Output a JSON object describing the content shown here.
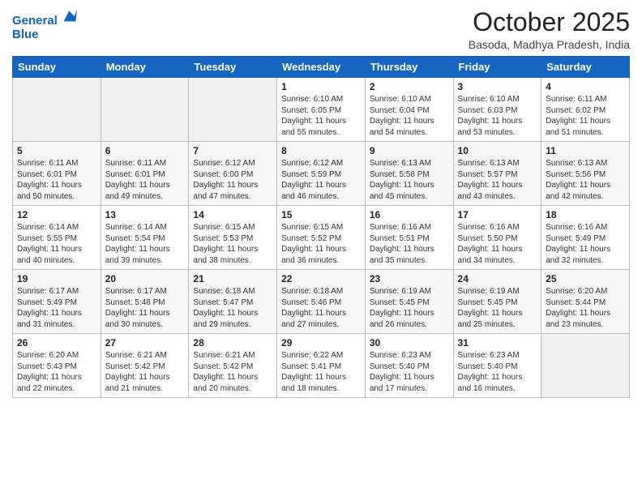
{
  "header": {
    "logo_line1": "General",
    "logo_line2": "Blue",
    "month": "October 2025",
    "location": "Basoda, Madhya Pradesh, India"
  },
  "weekdays": [
    "Sunday",
    "Monday",
    "Tuesday",
    "Wednesday",
    "Thursday",
    "Friday",
    "Saturday"
  ],
  "weeks": [
    [
      {
        "day": "",
        "empty": true
      },
      {
        "day": "",
        "empty": true
      },
      {
        "day": "",
        "empty": true
      },
      {
        "day": "1",
        "info": "Sunrise: 6:10 AM\nSunset: 6:05 PM\nDaylight: 11 hours\nand 55 minutes."
      },
      {
        "day": "2",
        "info": "Sunrise: 6:10 AM\nSunset: 6:04 PM\nDaylight: 11 hours\nand 54 minutes."
      },
      {
        "day": "3",
        "info": "Sunrise: 6:10 AM\nSunset: 6:03 PM\nDaylight: 11 hours\nand 53 minutes."
      },
      {
        "day": "4",
        "info": "Sunrise: 6:11 AM\nSunset: 6:02 PM\nDaylight: 11 hours\nand 51 minutes."
      }
    ],
    [
      {
        "day": "5",
        "info": "Sunrise: 6:11 AM\nSunset: 6:01 PM\nDaylight: 11 hours\nand 50 minutes."
      },
      {
        "day": "6",
        "info": "Sunrise: 6:11 AM\nSunset: 6:01 PM\nDaylight: 11 hours\nand 49 minutes."
      },
      {
        "day": "7",
        "info": "Sunrise: 6:12 AM\nSunset: 6:00 PM\nDaylight: 11 hours\nand 47 minutes."
      },
      {
        "day": "8",
        "info": "Sunrise: 6:12 AM\nSunset: 5:59 PM\nDaylight: 11 hours\nand 46 minutes."
      },
      {
        "day": "9",
        "info": "Sunrise: 6:13 AM\nSunset: 5:58 PM\nDaylight: 11 hours\nand 45 minutes."
      },
      {
        "day": "10",
        "info": "Sunrise: 6:13 AM\nSunset: 5:57 PM\nDaylight: 11 hours\nand 43 minutes."
      },
      {
        "day": "11",
        "info": "Sunrise: 6:13 AM\nSunset: 5:56 PM\nDaylight: 11 hours\nand 42 minutes."
      }
    ],
    [
      {
        "day": "12",
        "info": "Sunrise: 6:14 AM\nSunset: 5:55 PM\nDaylight: 11 hours\nand 40 minutes."
      },
      {
        "day": "13",
        "info": "Sunrise: 6:14 AM\nSunset: 5:54 PM\nDaylight: 11 hours\nand 39 minutes."
      },
      {
        "day": "14",
        "info": "Sunrise: 6:15 AM\nSunset: 5:53 PM\nDaylight: 11 hours\nand 38 minutes."
      },
      {
        "day": "15",
        "info": "Sunrise: 6:15 AM\nSunset: 5:52 PM\nDaylight: 11 hours\nand 36 minutes."
      },
      {
        "day": "16",
        "info": "Sunrise: 6:16 AM\nSunset: 5:51 PM\nDaylight: 11 hours\nand 35 minutes."
      },
      {
        "day": "17",
        "info": "Sunrise: 6:16 AM\nSunset: 5:50 PM\nDaylight: 11 hours\nand 34 minutes."
      },
      {
        "day": "18",
        "info": "Sunrise: 6:16 AM\nSunset: 5:49 PM\nDaylight: 11 hours\nand 32 minutes."
      }
    ],
    [
      {
        "day": "19",
        "info": "Sunrise: 6:17 AM\nSunset: 5:49 PM\nDaylight: 11 hours\nand 31 minutes."
      },
      {
        "day": "20",
        "info": "Sunrise: 6:17 AM\nSunset: 5:48 PM\nDaylight: 11 hours\nand 30 minutes."
      },
      {
        "day": "21",
        "info": "Sunrise: 6:18 AM\nSunset: 5:47 PM\nDaylight: 11 hours\nand 29 minutes."
      },
      {
        "day": "22",
        "info": "Sunrise: 6:18 AM\nSunset: 5:46 PM\nDaylight: 11 hours\nand 27 minutes."
      },
      {
        "day": "23",
        "info": "Sunrise: 6:19 AM\nSunset: 5:45 PM\nDaylight: 11 hours\nand 26 minutes."
      },
      {
        "day": "24",
        "info": "Sunrise: 6:19 AM\nSunset: 5:45 PM\nDaylight: 11 hours\nand 25 minutes."
      },
      {
        "day": "25",
        "info": "Sunrise: 6:20 AM\nSunset: 5:44 PM\nDaylight: 11 hours\nand 23 minutes."
      }
    ],
    [
      {
        "day": "26",
        "info": "Sunrise: 6:20 AM\nSunset: 5:43 PM\nDaylight: 11 hours\nand 22 minutes."
      },
      {
        "day": "27",
        "info": "Sunrise: 6:21 AM\nSunset: 5:42 PM\nDaylight: 11 hours\nand 21 minutes."
      },
      {
        "day": "28",
        "info": "Sunrise: 6:21 AM\nSunset: 5:42 PM\nDaylight: 11 hours\nand 20 minutes."
      },
      {
        "day": "29",
        "info": "Sunrise: 6:22 AM\nSunset: 5:41 PM\nDaylight: 11 hours\nand 18 minutes."
      },
      {
        "day": "30",
        "info": "Sunrise: 6:23 AM\nSunset: 5:40 PM\nDaylight: 11 hours\nand 17 minutes."
      },
      {
        "day": "31",
        "info": "Sunrise: 6:23 AM\nSunset: 5:40 PM\nDaylight: 11 hours\nand 16 minutes."
      },
      {
        "day": "",
        "empty": true
      }
    ]
  ]
}
